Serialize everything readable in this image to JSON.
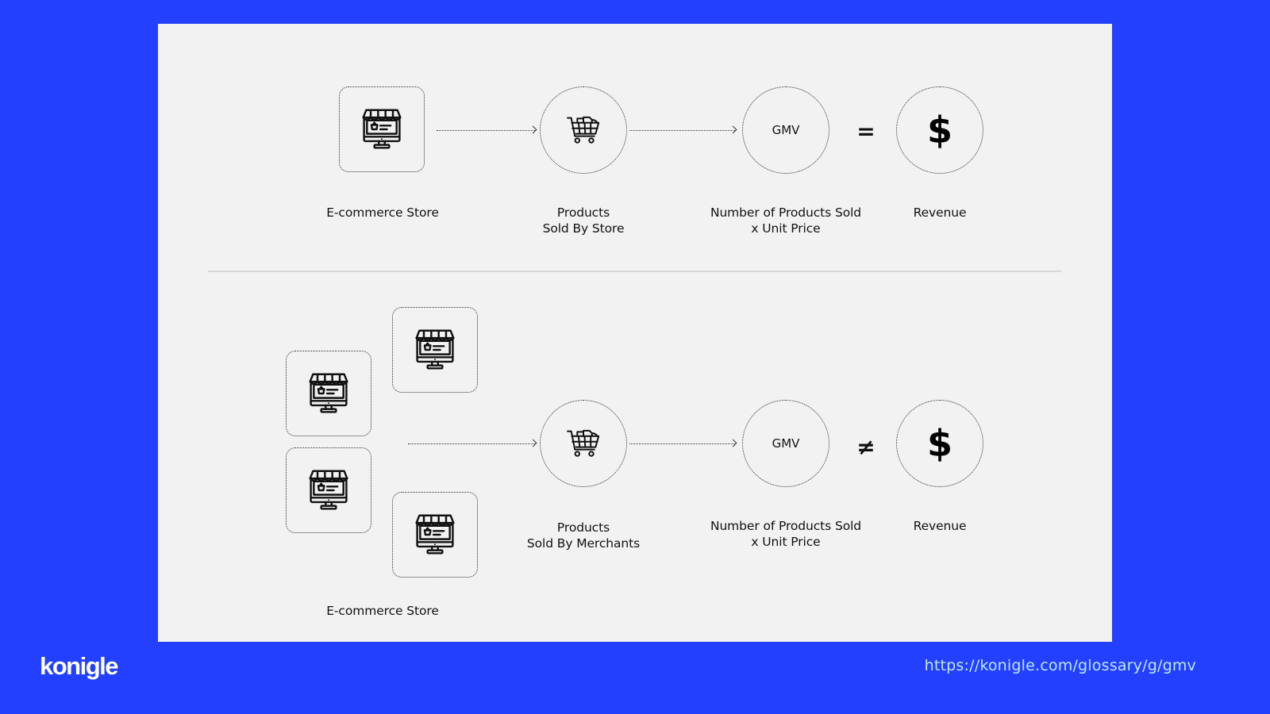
{
  "diagram": {
    "top_flow": {
      "store_label": "E-commerce Store",
      "cart_label_line1": "Products",
      "cart_label_line2": "Sold By Store",
      "gmv_text": "GMV",
      "gmv_label_line1": "Number of Products Sold",
      "gmv_label_line2": "x Unit Price",
      "operator": "=",
      "revenue_symbol": "$",
      "revenue_label": "Revenue",
      "icons": [
        "storefront-monitor-icon",
        "shopping-cart-icon",
        "dollar-icon"
      ]
    },
    "bottom_flow": {
      "store_label": "E-commerce Store",
      "store_count": 4,
      "cart_label_line1": "Products",
      "cart_label_line2": "Sold By Merchants",
      "gmv_text": "GMV",
      "gmv_label_line1": "Number of Products Sold",
      "gmv_label_line2": "x Unit Price",
      "operator": "≠",
      "revenue_symbol": "$",
      "revenue_label": "Revenue",
      "icons": [
        "storefront-monitor-icon",
        "shopping-cart-icon",
        "dollar-icon"
      ]
    }
  },
  "footer": {
    "logo": "konigle",
    "url": "https://konigle.com/glossary/g/gmv"
  },
  "colors": {
    "background": "#2340ff",
    "panel": "#f2f2f2",
    "url_text": "#bfe9ff",
    "ink": "#111111"
  }
}
